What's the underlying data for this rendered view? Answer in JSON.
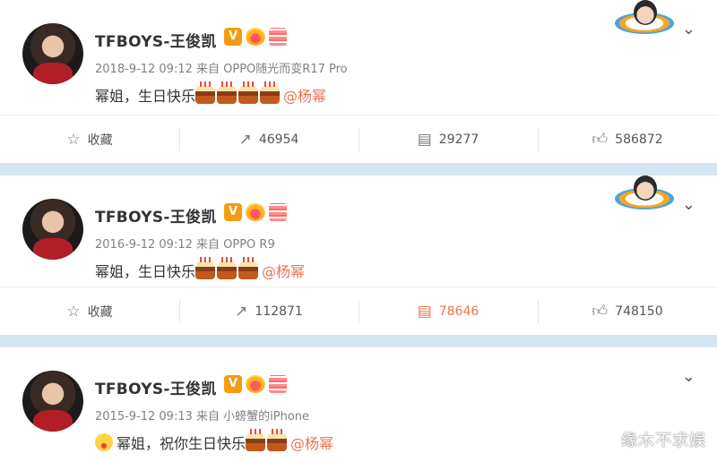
{
  "posts": [
    {
      "username": "TFBOYS-王俊凯",
      "verified_badge": "V",
      "meta": "2018-9-12 09:12 来自 OPPO随光而变R17 Pro",
      "text": "幂姐，生日快乐",
      "cakes": 4,
      "mention": "@杨幂",
      "actions": {
        "favorite": "收藏",
        "repost": "46954",
        "comment": "29277",
        "like": "586872"
      },
      "comment_highlight": false
    },
    {
      "username": "TFBOYS-王俊凯",
      "verified_badge": "V",
      "meta": "2016-9-12 09:12 来自 OPPO R9",
      "text": "幂姐，生日快乐",
      "cakes": 3,
      "mention": "@杨幂",
      "actions": {
        "favorite": "收藏",
        "repost": "112871",
        "comment": "78646",
        "like": "748150"
      },
      "comment_highlight": true
    },
    {
      "username": "TFBOYS-王俊凯",
      "verified_badge": "V",
      "meta": "2015-9-12 09:13 来自 小螃蟹的iPhone",
      "text": "幂姐，祝你生日快乐",
      "cakes": 2,
      "mention": "@杨幂"
    }
  ],
  "icons": {
    "favorite": "star-outline-icon",
    "repost": "repost-icon",
    "comment": "comment-icon",
    "like": "thumbs-up-icon",
    "more": "chevron-down-icon"
  },
  "colors": {
    "accent": "#eb7350",
    "separator": "#d4e6f1",
    "badge": "#f39c12"
  },
  "watermark": "缘木不求娱"
}
